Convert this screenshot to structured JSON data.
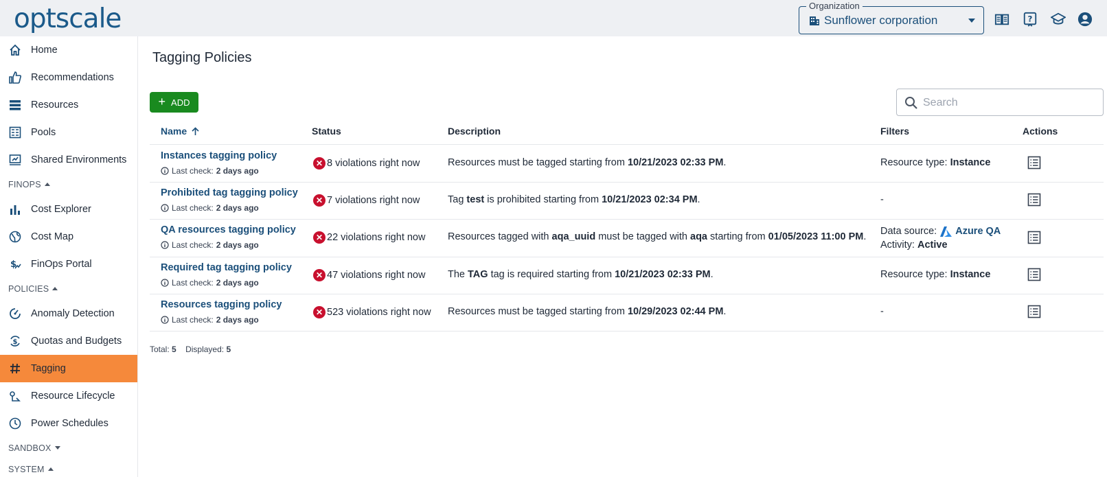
{
  "header": {
    "logo": "optscale",
    "org_label": "Organization",
    "org_value": "Sunflower corporation",
    "icons": [
      "documentation-icon",
      "help-icon",
      "education-icon",
      "account-icon"
    ]
  },
  "sidebar": {
    "items": [
      {
        "label": "Home",
        "icon": "home-icon"
      },
      {
        "label": "Recommendations",
        "icon": "thumbs-up-icon"
      },
      {
        "label": "Resources",
        "icon": "list-icon"
      },
      {
        "label": "Pools",
        "icon": "pools-icon"
      },
      {
        "label": "Shared Environments",
        "icon": "shared-env-icon"
      }
    ],
    "finops_label": "FINOPS",
    "finops_items": [
      {
        "label": "Cost Explorer",
        "icon": "bar-chart-icon"
      },
      {
        "label": "Cost Map",
        "icon": "globe-icon"
      },
      {
        "label": "FinOps Portal",
        "icon": "finops-icon"
      }
    ],
    "policies_label": "POLICIES",
    "policies_items": [
      {
        "label": "Anomaly Detection",
        "icon": "anomaly-icon"
      },
      {
        "label": "Quotas and Budgets",
        "icon": "quotas-icon"
      },
      {
        "label": "Tagging",
        "icon": "hash-icon"
      },
      {
        "label": "Resource Lifecycle",
        "icon": "lifecycle-icon"
      },
      {
        "label": "Power Schedules",
        "icon": "clock-icon"
      }
    ],
    "sandbox_label": "SANDBOX",
    "system_label": "SYSTEM"
  },
  "main": {
    "title": "Tagging Policies",
    "add_label": "ADD",
    "search_placeholder": "Search",
    "columns": {
      "name": "Name",
      "status": "Status",
      "description": "Description",
      "filters": "Filters",
      "actions": "Actions"
    },
    "last_check_label": "Last check:",
    "rows": [
      {
        "name": "Instances tagging policy",
        "last_check": "2 days ago",
        "status": "8 violations right now",
        "desc": [
          "Resources must be tagged starting from ",
          "10/21/2023 02:33 PM",
          "."
        ],
        "filter_label": "Resource type:",
        "filter_value": "Instance"
      },
      {
        "name": "Prohibited tag tagging policy",
        "last_check": "2 days ago",
        "status": "7 violations right now",
        "desc": [
          "Tag ",
          "test",
          " is prohibited starting from ",
          "10/21/2023 02:34 PM",
          "."
        ],
        "filter_none": "-"
      },
      {
        "name": "QA resources tagging policy",
        "last_check": "2 days ago",
        "status": "22 violations right now",
        "desc": [
          "Resources tagged with ",
          "aqa_uuid",
          " must be tagged with ",
          "aqa",
          " starting from ",
          "01/05/2023 11:00 PM",
          "."
        ],
        "ds_label": "Data source:",
        "ds_value": "Azure QA",
        "activity_label": "Activity:",
        "activity_value": "Active"
      },
      {
        "name": "Required tag tagging policy",
        "last_check": "2 days ago",
        "status": "47 violations right now",
        "desc": [
          "The ",
          "TAG",
          " tag is required starting from ",
          "10/21/2023 02:33 PM",
          "."
        ],
        "filter_label": "Resource type:",
        "filter_value": "Instance"
      },
      {
        "name": "Resources tagging policy",
        "last_check": "2 days ago",
        "status": "523 violations right now",
        "desc": [
          "Resources must be tagged starting from ",
          "10/29/2023 02:44 PM",
          "."
        ],
        "filter_none": "-"
      }
    ],
    "total_label": "Total:",
    "total_value": "5",
    "displayed_label": "Displayed:",
    "displayed_value": "5"
  },
  "colors": {
    "brand": "#1b4f7a",
    "active_nav": "#f5893b",
    "add_button": "#198a1f",
    "violation": "#c8102e"
  }
}
